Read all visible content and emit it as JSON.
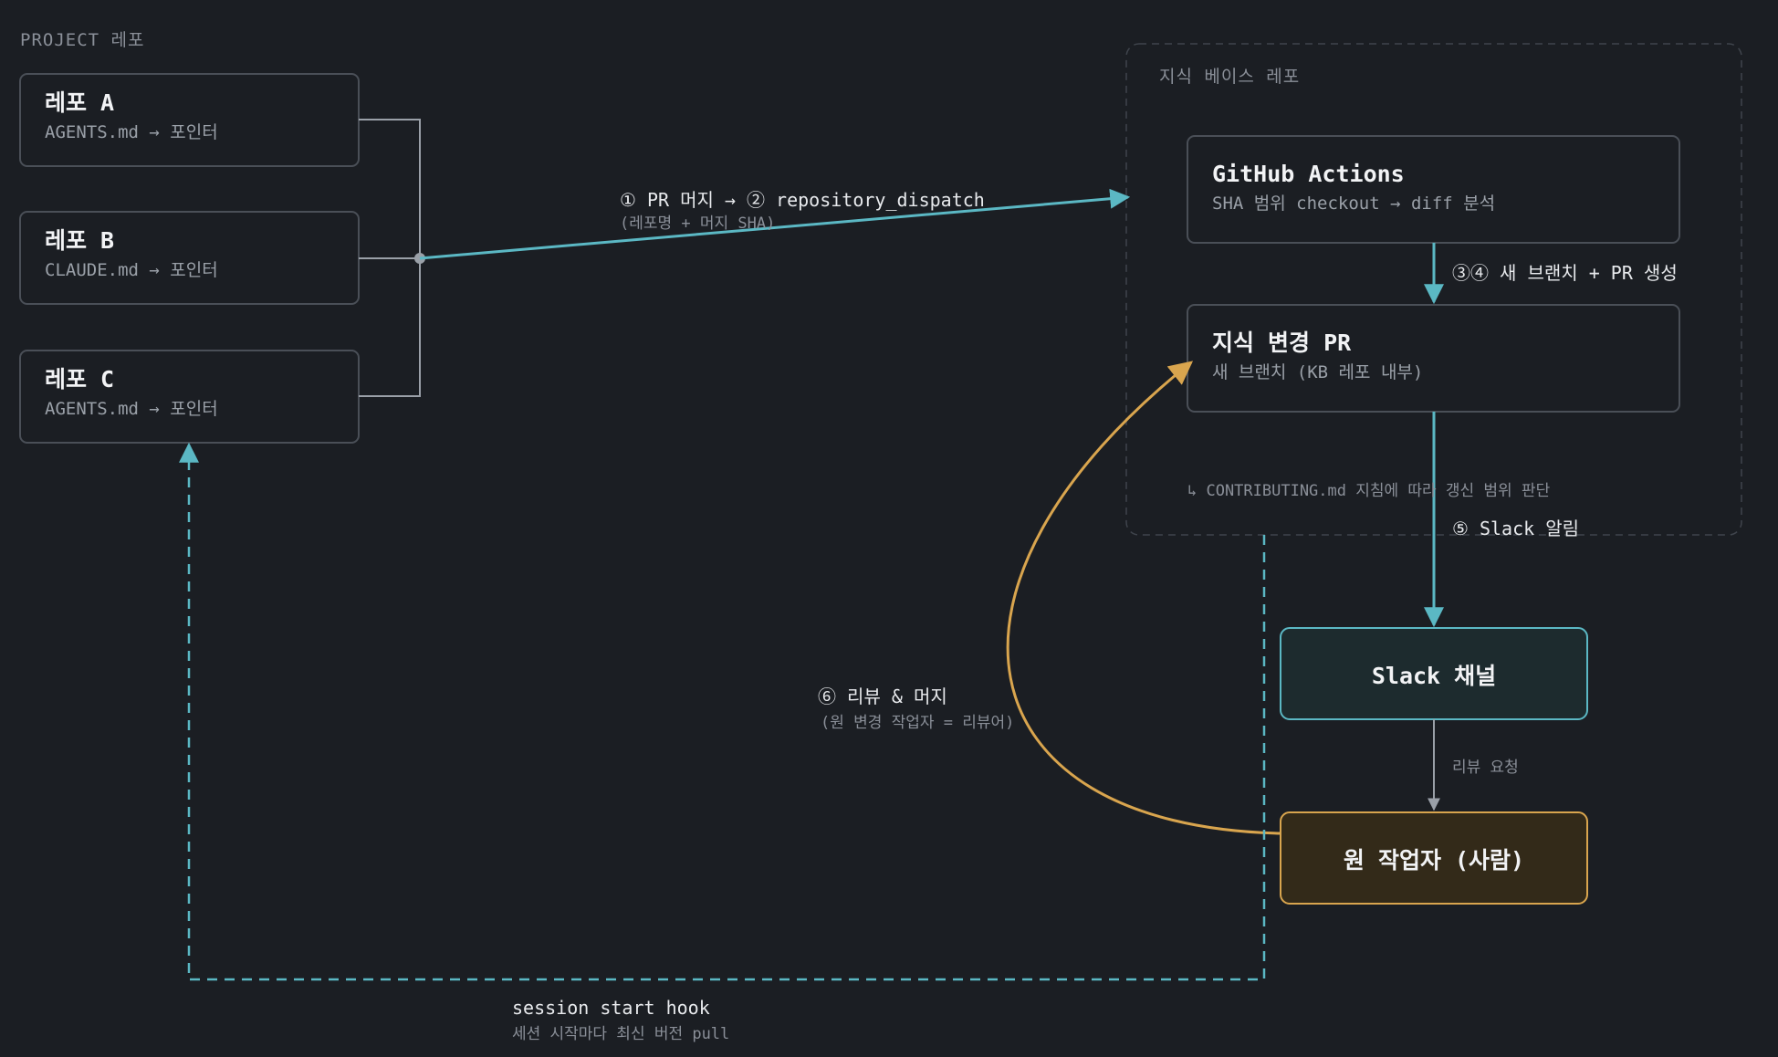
{
  "groups": {
    "project_repos": "PROJECT 레포",
    "knowledge_base": "지식 베이스 레포"
  },
  "repos": [
    {
      "title": "레포 A",
      "subtitle": "AGENTS.md → 포인터"
    },
    {
      "title": "레포 B",
      "subtitle": "CLAUDE.md → 포인터"
    },
    {
      "title": "레포 C",
      "subtitle": "AGENTS.md → 포인터"
    }
  ],
  "github_actions": {
    "title": "GitHub Actions",
    "subtitle": "SHA 범위 checkout → diff 분석"
  },
  "knowledge_pr": {
    "title": "지식 변경 PR",
    "subtitle": "새 브랜치 (KB 레포 내부)"
  },
  "contributing_note": "↳ CONTRIBUTING.md 지침에 따라 갱신 범위 판단",
  "slack": {
    "title": "Slack 채널"
  },
  "author": {
    "title": "원 작업자 (사람)"
  },
  "edges": {
    "dispatch_label": "① PR 머지 → ② repository_dispatch",
    "dispatch_sub": "(레포명 + 머지 SHA)",
    "branch_pr": "③④ 새 브랜치 + PR 생성",
    "slack_notify": "⑤ Slack 알림",
    "review_request": "리뷰 요청",
    "review_merge": "⑥ 리뷰 & 머지",
    "review_merge_sub": "(원 변경 작업자 = 리뷰어)",
    "hook_label": "session start hook",
    "hook_sub": "세션 시작마다 최신 버전 pull"
  },
  "colors": {
    "background": "#1b1e23",
    "box_border": "#4a4f57",
    "teal": "#5bb8c4",
    "orange": "#d9a54e",
    "slack_fill": "#1d2b2e",
    "author_fill": "#332a19"
  }
}
